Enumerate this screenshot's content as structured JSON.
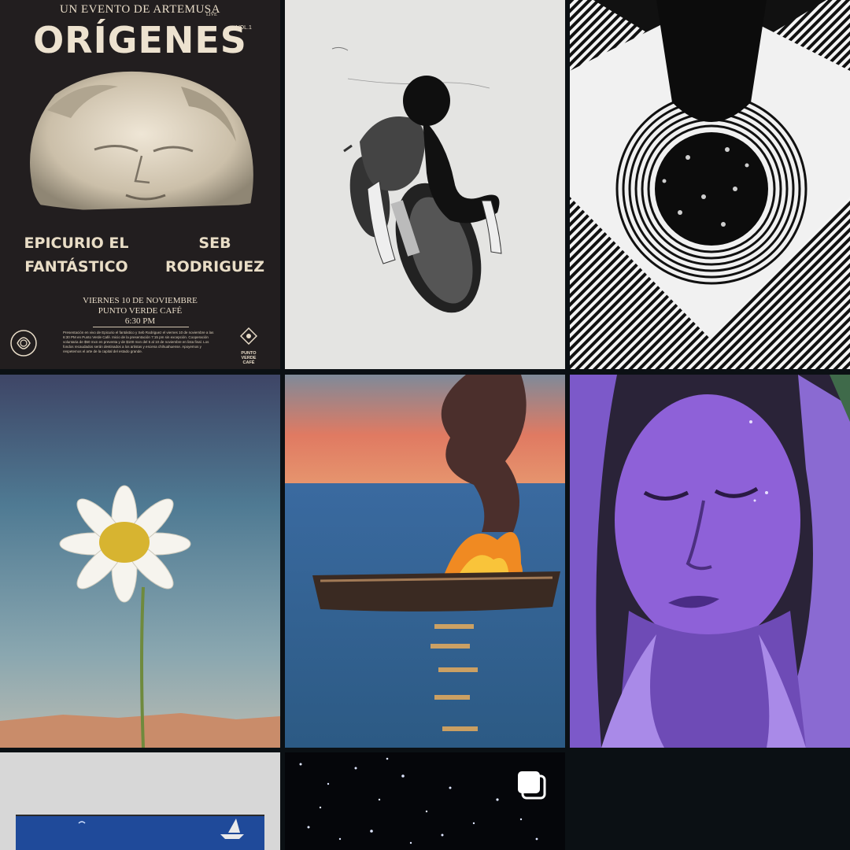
{
  "grid": {
    "background": "#0b1014",
    "tiles": [
      {
        "name": "poster-origenes"
      },
      {
        "name": "couple-motorcycle-drawing"
      },
      {
        "name": "geometric-portal-art"
      },
      {
        "name": "daisy-painting"
      },
      {
        "name": "burning-boat-painting"
      },
      {
        "name": "purple-woman-painting"
      },
      {
        "name": "blue-boat-painting"
      },
      {
        "name": "starry-night-post",
        "icon": "multiple-images-icon"
      }
    ]
  },
  "poster": {
    "presenter": "UN EVENTO DE ARTEMUSA",
    "live": "LIVE",
    "title": "ORÍGENES",
    "volume": "VOL.1",
    "artist1_line1": "EPICURIO EL",
    "artist1_line2": "FANTÁSTICO",
    "artist2_line1": "SEB",
    "artist2_line2": "RODRIGUEZ",
    "date": "VIERNES 10 DE NOVIEMBRE",
    "venue": "PUNTO VERDE CAFÉ",
    "time": "6:30 PM",
    "description": "Presentación en vivo de Epicurio el fantástico y Seb Rodriguez el viernes 10 de noviembre a las 6:30 PM en Punto Verde Café. Inicio de la presentación 7:15 pm sin excepción. Cooperación voluntaria de $50 mxn en preventa y de $100 mxn del 5 al 10 de noviembre en lista final. Los fondos recaudados serán destinados a los artistas y escena chihuahuense. Apoyemos y respetemos el arte de la capital del estado grande.",
    "venue_logo_line1": "PUNTO",
    "venue_logo_line2": "VERDE",
    "venue_logo_line3": "CAFÉ"
  }
}
